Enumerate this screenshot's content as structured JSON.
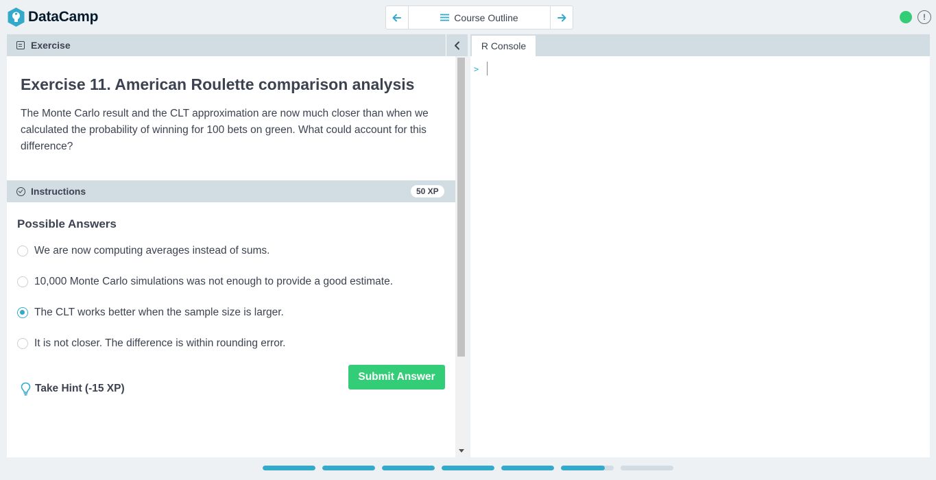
{
  "brand": {
    "name": "DataCamp",
    "logo_icon": "datacamp-logo-icon"
  },
  "nav": {
    "prev_icon": "arrow-left-icon",
    "center_icon": "menu-icon",
    "center_label": "Course Outline",
    "next_icon": "arrow-right-icon"
  },
  "status": {
    "dot_color": "#33cc77",
    "alert_glyph": "!"
  },
  "exercise_panel": {
    "header_label": "Exercise",
    "title": "Exercise 11. American Roulette comparison analysis",
    "description": "The Monte Carlo result and the CLT approximation are now much closer than when we calculated the probability of winning for 100 bets on green. What could account for this difference?"
  },
  "instructions": {
    "header_label": "Instructions",
    "xp": "50 XP",
    "answers_title": "Possible Answers",
    "answers": [
      {
        "label": "We are now computing averages instead of sums.",
        "selected": false
      },
      {
        "label": "10,000 Monte Carlo simulations was not enough to provide a good estimate.",
        "selected": false
      },
      {
        "label": "The CLT works better when the sample size is larger.",
        "selected": true
      },
      {
        "label": "It is not closer. The difference is within rounding error.",
        "selected": false
      }
    ],
    "submit_label": "Submit Answer",
    "hint_label": "Take Hint (-15 XP)"
  },
  "console": {
    "tab_label": "R Console",
    "prompt": ">"
  },
  "progress": {
    "segments": [
      1,
      1,
      1,
      1,
      1,
      0.83,
      0
    ],
    "fill_color": "#33aacc"
  },
  "colors": {
    "accent": "#33aacc",
    "success": "#33cc77",
    "panel_header": "#d1dce3"
  }
}
